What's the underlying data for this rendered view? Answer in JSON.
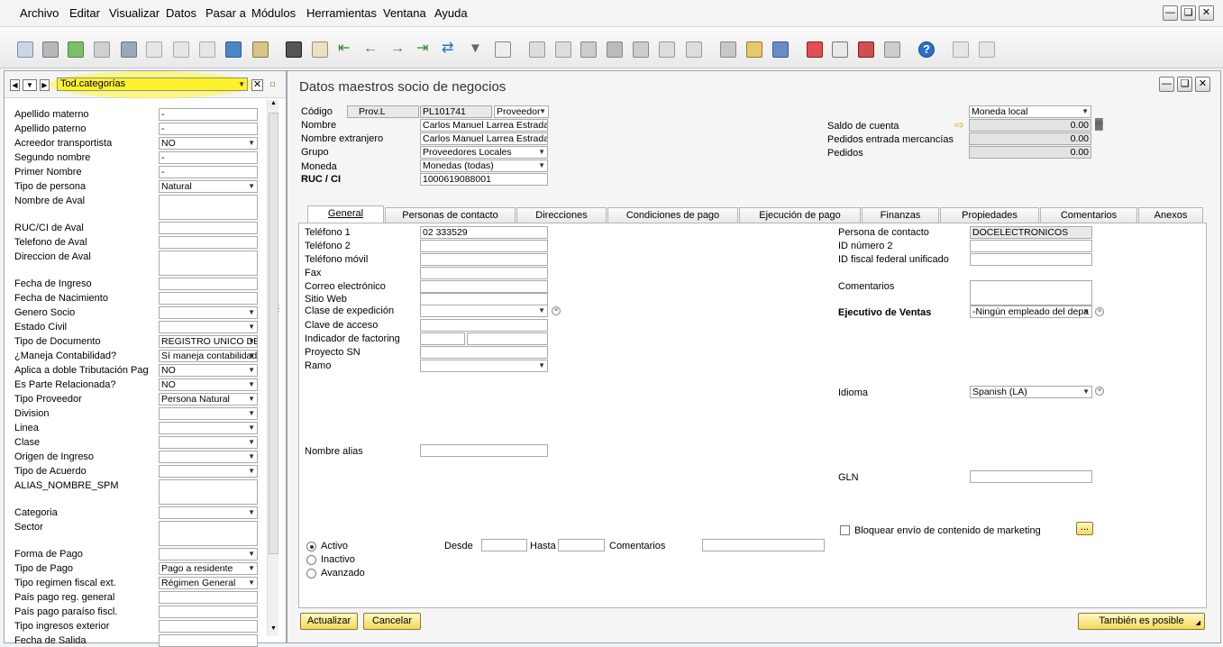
{
  "menu": [
    "Archivo",
    "Editar",
    "Visualizar",
    "Datos",
    "Pasar a",
    "Módulos",
    "Herramientas",
    "Ventana",
    "Ayuda"
  ],
  "left_panel": {
    "category": "Tod.categorías",
    "fields": [
      {
        "label": "Apellido materno",
        "value": "-"
      },
      {
        "label": "Apellido paterno",
        "value": "-"
      },
      {
        "label": "Acreedor transportista",
        "value": "NO"
      },
      {
        "label": "Segundo nombre",
        "value": "-"
      },
      {
        "label": "Primer Nombre",
        "value": "-"
      },
      {
        "label": "Tipo de persona",
        "value": "Natural"
      },
      {
        "label": "Nombre de Aval",
        "value": ""
      },
      {
        "label": "RUC/CI de Aval",
        "value": ""
      },
      {
        "label": "Telefono de Aval",
        "value": ""
      },
      {
        "label": "Direccion de Aval",
        "value": ""
      },
      {
        "label": "Fecha de Ingreso",
        "value": ""
      },
      {
        "label": "Fecha de Nacimiento",
        "value": ""
      },
      {
        "label": "Genero Socio",
        "value": ""
      },
      {
        "label": "Estado Civil",
        "value": ""
      },
      {
        "label": "Tipo de Documento",
        "value": "REGISTRO UNICO DE"
      },
      {
        "label": "¿Maneja Contabilidad?",
        "value": "Sí maneja contabilidad"
      },
      {
        "label": "Aplica a doble Tributación Pag",
        "value": "NO"
      },
      {
        "label": "Es Parte Relacionada?",
        "value": "NO"
      },
      {
        "label": "Tipo Proveedor",
        "value": "Persona Natural"
      },
      {
        "label": "Division",
        "value": ""
      },
      {
        "label": "Linea",
        "value": ""
      },
      {
        "label": "Clase",
        "value": ""
      },
      {
        "label": "Origen de Ingreso",
        "value": ""
      },
      {
        "label": "Tipo de Acuerdo",
        "value": ""
      },
      {
        "label": "ALIAS_NOMBRE_SPM",
        "value": ""
      },
      {
        "label": "Categoria",
        "value": ""
      },
      {
        "label": "Sector",
        "value": ""
      },
      {
        "label": "Forma de Pago",
        "value": ""
      },
      {
        "label": "Tipo de Pago",
        "value": "Pago a residente"
      },
      {
        "label": "Tipo regimen fiscal ext.",
        "value": "Régimen General"
      },
      {
        "label": "País pago reg. general",
        "value": ""
      },
      {
        "label": "País pago paraíso fiscl.",
        "value": ""
      },
      {
        "label": "Tipo ingresos exterior",
        "value": ""
      },
      {
        "label": "Fecha de Salida",
        "value": ""
      }
    ]
  },
  "main": {
    "title": "Datos maestros socio de negocios",
    "header": {
      "codigo_label": "Código",
      "codigo_series": "Prov.L",
      "codigo_value": "PL101741",
      "codigo_type": "Proveedor",
      "nombre_label": "Nombre",
      "nombre_value": "Carlos Manuel Larrea Estrada",
      "nombre_ext_label": "Nombre extranjero",
      "nombre_ext_value": "Carlos Manuel Larrea Estrada",
      "grupo_label": "Grupo",
      "grupo_value": "Proveedores Locales",
      "moneda_label": "Moneda",
      "moneda_value": "Monedas (todas)",
      "ruc_label": "RUC / CI",
      "ruc_value": "1000619088001"
    },
    "balances": {
      "currency": "Moneda local",
      "saldo_label": "Saldo de cuenta",
      "saldo_value": "0.00",
      "pedidos_entrada_label": "Pedidos entrada mercancías",
      "pedidos_entrada_value": "0.00",
      "pedidos_label": "Pedidos",
      "pedidos_value": "0.00"
    },
    "tabs": [
      "General",
      "Personas de contacto",
      "Direcciones",
      "Condiciones de pago",
      "Ejecución de pago",
      "Finanzas",
      "Propiedades",
      "Comentarios",
      "Anexos"
    ],
    "general": {
      "telefono1_label": "Teléfono 1",
      "telefono1_value": "02 333529",
      "telefono2_label": "Teléfono 2",
      "movil_label": "Teléfono móvil",
      "fax_label": "Fax",
      "correo_label": "Correo electrónico",
      "web_label": "Sitio Web",
      "expedicion_label": "Clase de expedición",
      "clave_label": "Clave de acceso",
      "factoring_label": "Indicador de factoring",
      "proyecto_label": "Proyecto SN",
      "ramo_label": "Ramo",
      "alias_label": "Nombre alias",
      "contacto_label": "Persona de contacto",
      "contacto_value": "DOCELECTRONICOS",
      "id2_label": "ID número 2",
      "idfiscal_label": "ID fiscal federal unificado",
      "comentarios_label": "Comentarios",
      "ejecutivo_label": "Ejecutivo de Ventas",
      "ejecutivo_value": "-Ningún empleado del depa",
      "idioma_label": "Idioma",
      "idioma_value": "Spanish (LA)",
      "gln_label": "GLN",
      "bloquear_label": "Bloquear envío de contenido de marketing",
      "ellipsis": "...",
      "activo": "Activo",
      "inactivo": "Inactivo",
      "avanzado": "Avanzado",
      "desde": "Desde",
      "hasta": "Hasta",
      "comentarios2": "Comentarios"
    },
    "buttons": {
      "actualizar": "Actualizar",
      "cancelar": "Cancelar",
      "tambien": "También es posible"
    }
  },
  "colors": {
    "highlight": "#fcf12a",
    "button": "#f4d85a"
  }
}
